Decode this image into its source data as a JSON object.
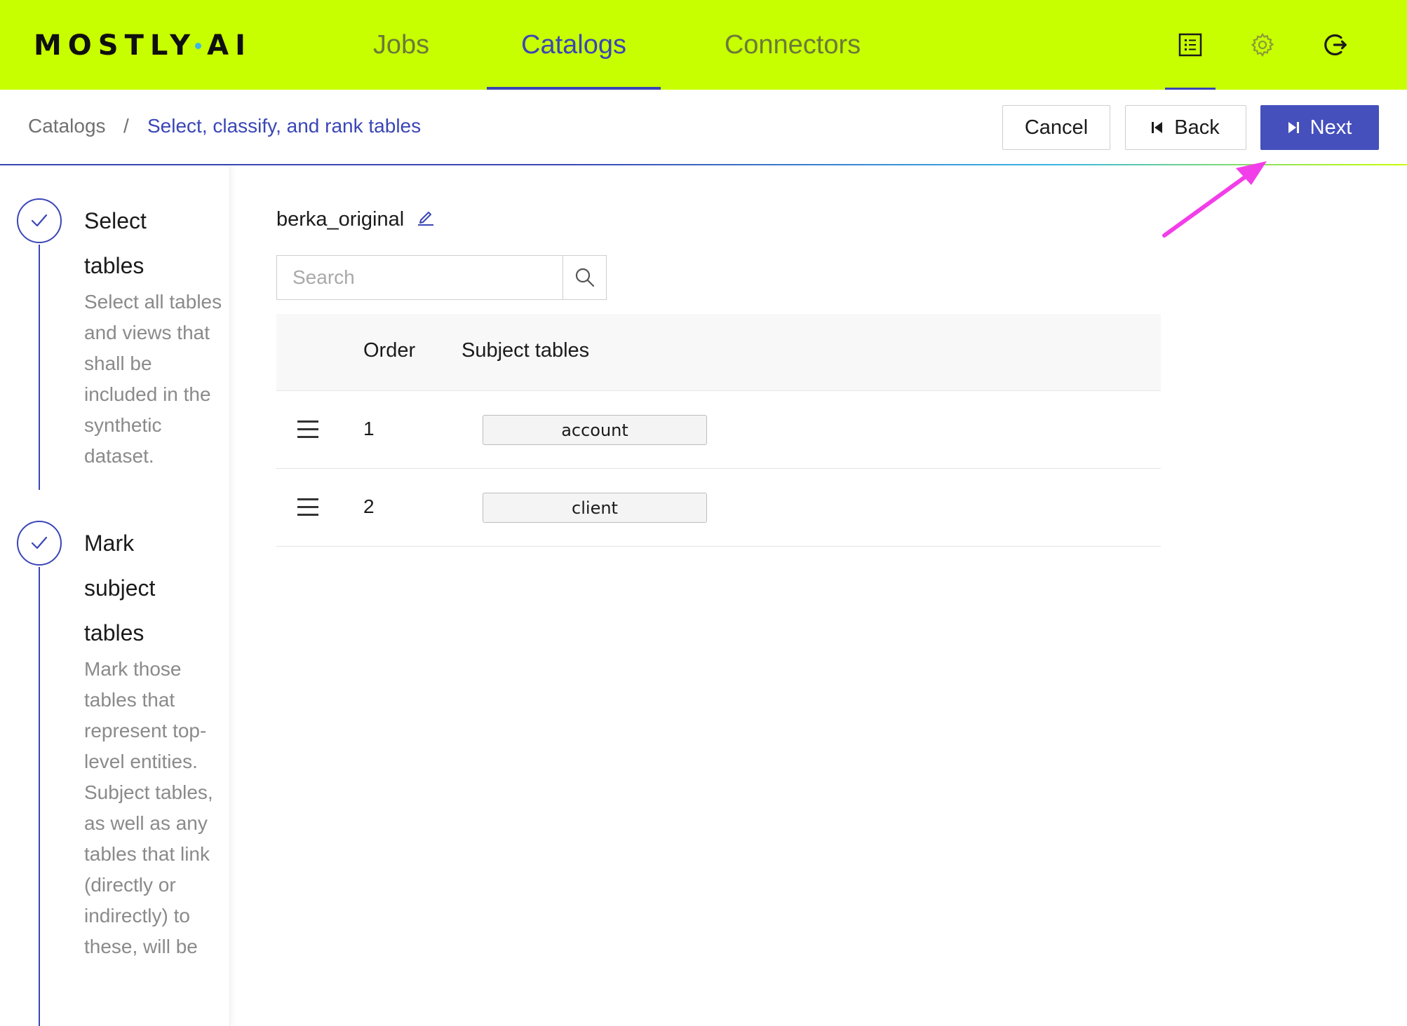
{
  "app": {
    "logo_left": "MOSTLY",
    "logo_right": "AI"
  },
  "nav": {
    "tabs": [
      {
        "label": "Jobs",
        "active": false
      },
      {
        "label": "Catalogs",
        "active": true
      },
      {
        "label": "Connectors",
        "active": false
      }
    ],
    "icons": [
      "list-icon",
      "gear-icon",
      "logout-icon"
    ]
  },
  "breadcrumb": {
    "root": "Catalogs",
    "separator": "/",
    "current": "Select, classify, and rank tables"
  },
  "actions": {
    "cancel_label": "Cancel",
    "back_label": "Back",
    "next_label": "Next"
  },
  "stepper": {
    "steps": [
      {
        "title_line1": "Select",
        "title_line2": "tables",
        "description": "Select all tables and views that shall be included in the synthetic dataset.",
        "status": "completed"
      },
      {
        "title_line1": "Mark",
        "title_line2": "subject",
        "title_line3": "tables",
        "description": "Mark those tables that represent top-level entities. Subject tables, as well as any tables that link (directly or indirectly) to these, will be",
        "status": "completed"
      }
    ]
  },
  "main": {
    "catalog_name": "berka_original",
    "search": {
      "placeholder": "Search",
      "value": ""
    },
    "table": {
      "headers": {
        "order": "Order",
        "subject": "Subject tables"
      },
      "rows": [
        {
          "order": "1",
          "table": "account"
        },
        {
          "order": "2",
          "table": "client"
        }
      ]
    }
  },
  "colors": {
    "brand_lime": "#c8ff00",
    "accent_blue": "#3a46b6",
    "primary_button": "#4550bd",
    "annotation_arrow": "#f23ee8"
  }
}
